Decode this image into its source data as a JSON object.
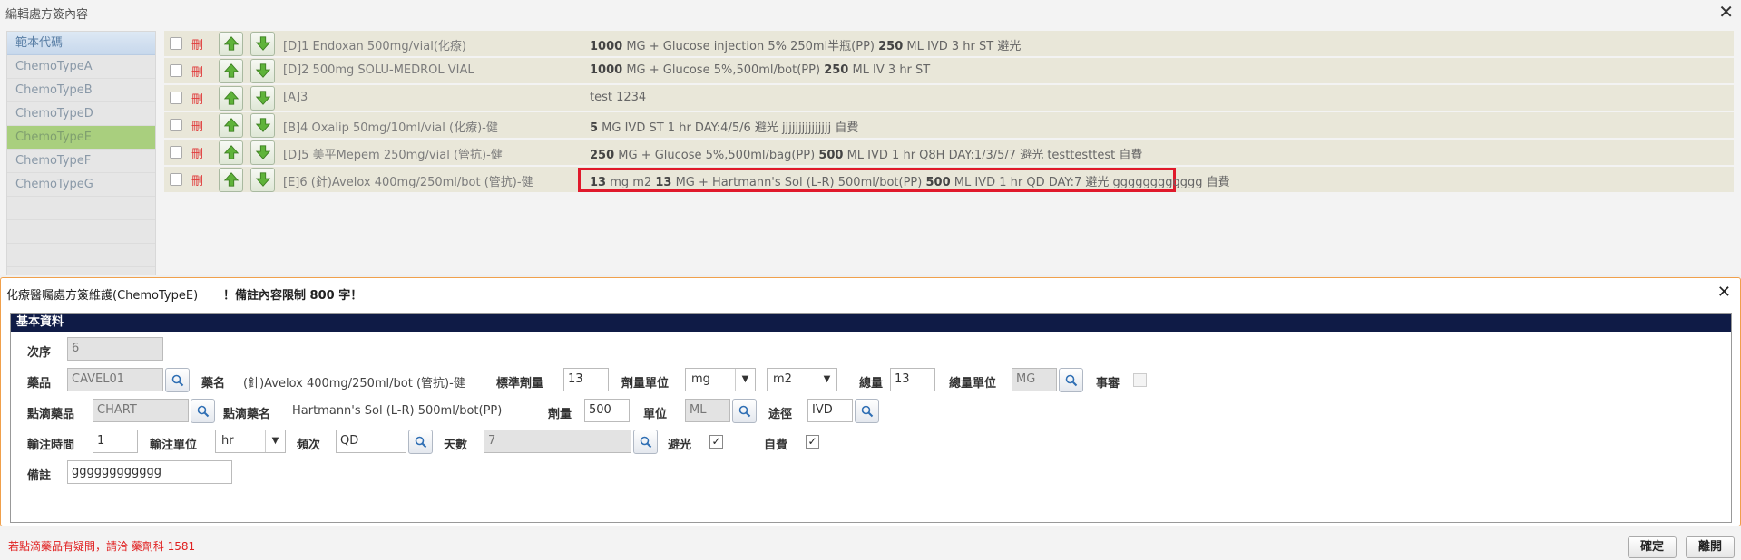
{
  "window": {
    "title": "編輯處方簽內容"
  },
  "sidebar": {
    "header": "範本代碼",
    "items": [
      "ChemoTypeA",
      "ChemoTypeB",
      "ChemoTypeD",
      "ChemoTypeE",
      "ChemoTypeF",
      "ChemoTypeG"
    ],
    "active": "ChemoTypeE"
  },
  "rows": [
    {
      "del": "刪",
      "name": "[D]1 Endoxan 500mg/vial(化療)",
      "q1": "1000",
      "t1": " MG  + Glucose injection 5% 250ml半瓶(PP) ",
      "q2": "250",
      "t2": " ML IVD 3 hr ST 避光"
    },
    {
      "del": "刪",
      "name": "[D]2 500mg SOLU-MEDROL VIAL",
      "q1": "1000",
      "t1": " MG  + Glucose 5%,500ml/bot(PP) ",
      "q2": "250",
      "t2": " ML IV 3 hr ST"
    },
    {
      "del": "刪",
      "name": "[A]3",
      "q1": "",
      "t1": "test 1234",
      "q2": "",
      "t2": ""
    },
    {
      "del": "刪",
      "name": "[B]4 Oxalip 50mg/10ml/vial (化療)-健",
      "q1": "5",
      "t1": " MG IVD ST 1 hr DAY:4/5/6 避光 jjjjjjjjjjjjjjj 自費",
      "q2": "",
      "t2": ""
    },
    {
      "del": "刪",
      "name": "[D]5 美平Mepem 250mg/vial (管抗)-健",
      "q1": "250",
      "t1": " MG  + Glucose 5%,500ml/bag(PP) ",
      "q2": "500",
      "t2": " ML IVD 1 hr Q8H DAY:1/3/5/7 避光 testtesttest 自費"
    },
    {
      "del": "刪",
      "name": "[E]6 (針)Avelox 400mg/250ml/bot (管抗)-健",
      "q1": "13",
      "t1": " mg m2 ",
      "q1b": "13",
      "t1b": " MG  + Hartmann's Sol (L-R) 500ml/bot(PP) ",
      "q2": "500",
      "t2": " ML IVD 1 hr QD DAY:7 避光 gggggggggggg 自費"
    }
  ],
  "panel": {
    "title": "化療醫囑處方簽維護(ChemoTypeE)",
    "warning": "！備註內容限制 800 字！",
    "section": "基本資料",
    "labels": {
      "seq": "次序",
      "drug": "藥品",
      "drug_name": "藥名",
      "std_dose": "標準劑量",
      "dose_unit": "劑量單位",
      "total": "總量",
      "total_unit": "總量單位",
      "review": "事審",
      "drip_drug": "點滴藥品",
      "drip_name": "點滴藥名",
      "amount": "劑量",
      "unit": "單位",
      "route": "途徑",
      "infuse_time": "輸注時間",
      "infuse_unit": "輸注單位",
      "freq": "頻次",
      "days": "天數",
      "light": "避光",
      "self_pay": "自費",
      "remark": "備註"
    },
    "values": {
      "seq": "6",
      "drug": "CAVEL01",
      "drug_name": "(針)Avelox 400mg/250ml/bot (管抗)-健",
      "std_dose": "13",
      "dose_unit": "mg",
      "dose_unit2": "m2",
      "total": "13",
      "total_unit": "MG",
      "drip_drug": "CHART",
      "drip_name": "Hartmann's Sol (L-R) 500ml/bot(PP)",
      "amount": "500",
      "unit": "ML",
      "route": "IVD",
      "infuse_time": "1",
      "infuse_unit": "hr",
      "freq": "QD",
      "days": "7",
      "remark": "gggggggggggg"
    },
    "checks": {
      "review": false,
      "light": true,
      "self_pay": true
    }
  },
  "footer": {
    "note": "若點滴藥品有疑問，請洽 藥劑科 1581",
    "confirm": "確定",
    "leave": "離開"
  },
  "colors": {
    "accent_green": "#a9cf7e",
    "header_navy": "#0f1b46",
    "highlight_red": "#e0192b",
    "panel_border": "#f0a04b"
  }
}
